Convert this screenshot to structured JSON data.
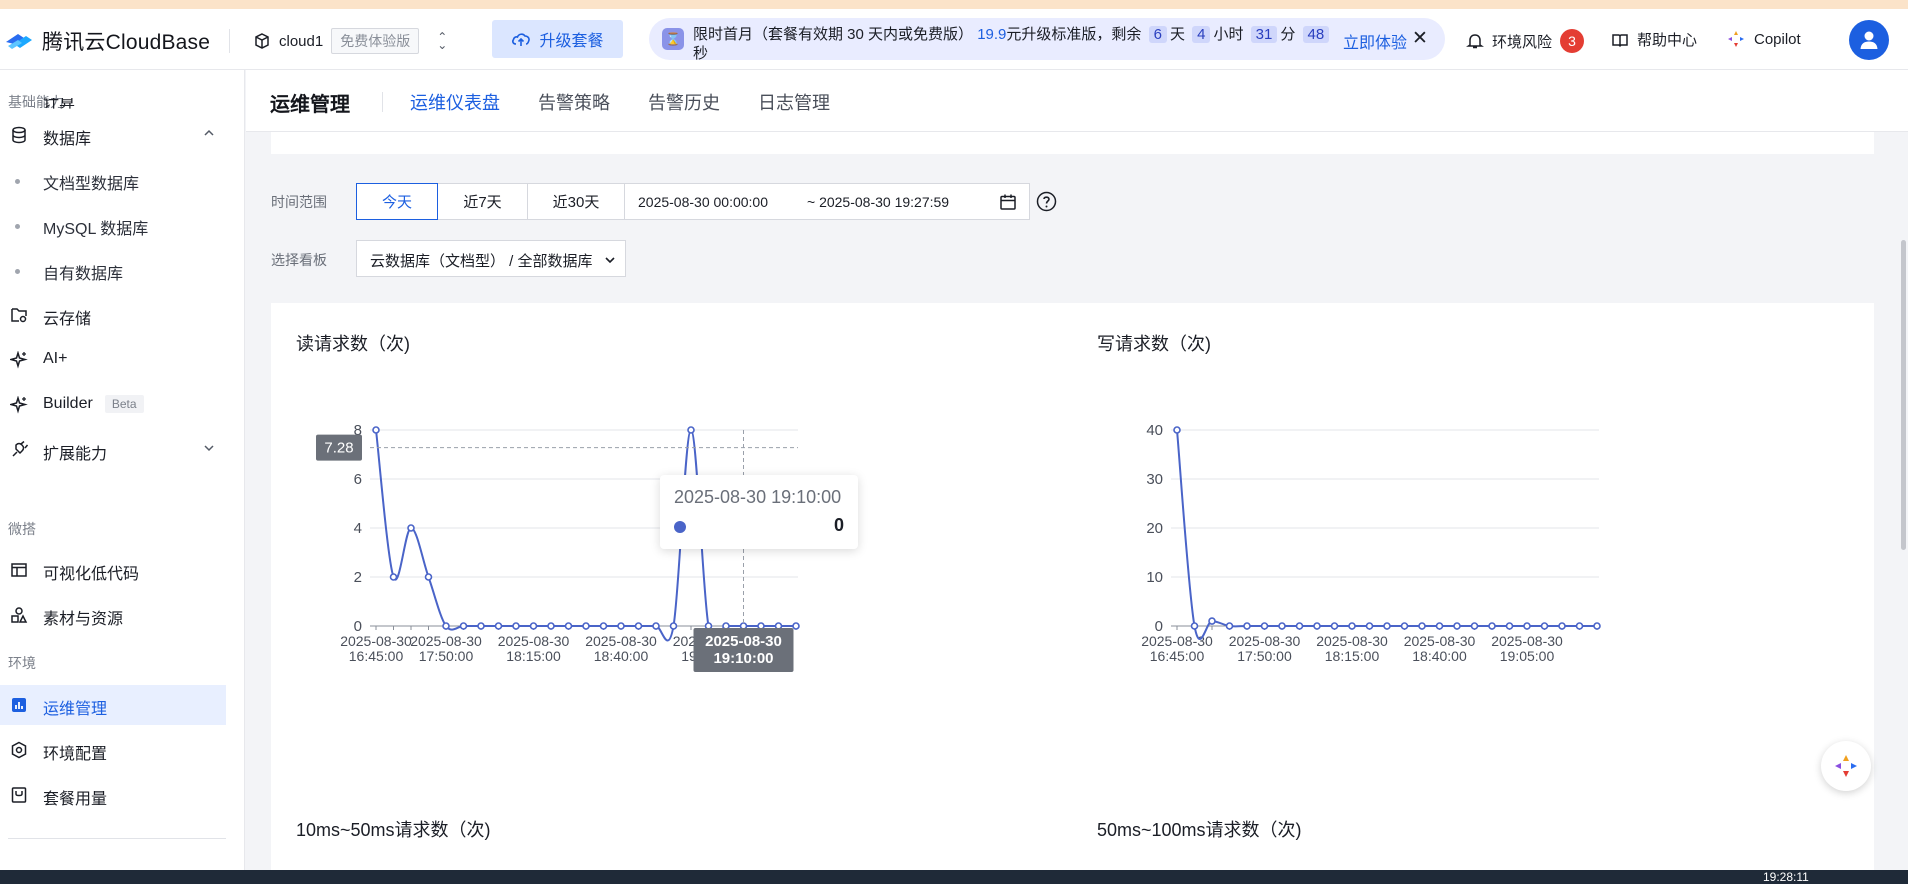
{
  "app": {
    "logo_text": "腾讯云CloudBase"
  },
  "header": {
    "env_name": "cloud1",
    "env_badge": "免费体验版",
    "upgrade_label": "升级套餐",
    "promo": {
      "line1_pre": "限时首月（套餐有效期 30 天内或免费版）",
      "price": "19.9",
      "line1_mid": "元升级标准版，剩余",
      "days": "6",
      "days_unit": "天",
      "hours": "4",
      "hours_unit": "小时",
      "minutes": "31",
      "minutes_unit": "分",
      "seconds": "48",
      "seconds_unit": "秒",
      "try_label": "立即体验"
    },
    "risk_label": "环境风险",
    "risk_count": "3",
    "help_label": "帮助中心",
    "copilot_label": "Copilot"
  },
  "sidebar": {
    "section_basic": "基础能力",
    "compute_partial": "计算",
    "database": "数据库",
    "doc_db": "文档型数据库",
    "mysql_db": "MySQL 数据库",
    "own_db": "自有数据库",
    "storage": "云存储",
    "ai": "AI+",
    "builder": "Builder",
    "builder_badge": "Beta",
    "extensions": "扩展能力",
    "section_weda": "微搭",
    "lowcode": "可视化低代码",
    "materials": "素材与资源",
    "section_env": "环境",
    "ops": "运维管理",
    "env_config": "环境配置",
    "usage": "套餐用量"
  },
  "page": {
    "title": "运维管理",
    "tabs": [
      "运维仪表盘",
      "告警策略",
      "告警历史",
      "日志管理"
    ]
  },
  "filters": {
    "time_label": "时间范围",
    "ranges": [
      "今天",
      "近7天",
      "近30天"
    ],
    "start": "2025-08-30 00:00:00",
    "end": "~ 2025-08-30 19:27:59",
    "board_label": "选择看板",
    "board_value": "云数据库（文档型）  / 全部数据库"
  },
  "charts_titles": {
    "read": "读请求数（次)",
    "write": "写请求数（次)",
    "c10_50": "10ms~50ms请求数（次)",
    "c50_100": "50ms~100ms请求数（次)"
  },
  "tooltip": {
    "time": "2025-08-30 19:10:00",
    "value": "0"
  },
  "crosshair": {
    "y_label": "7.28",
    "x_label_line1": "2025-08-30",
    "x_label_line2": "19:10:00"
  },
  "colors": {
    "accent": "#1c5fe0",
    "series": "#4a64c8",
    "risk": "#e43d33"
  },
  "chart_data": [
    {
      "type": "line",
      "title": "读请求数（次)",
      "ylim": [
        0,
        8
      ],
      "yticks": [
        0,
        2,
        4,
        6,
        8
      ],
      "xtick_labels": [
        [
          "2025-08-30",
          "16:45:00"
        ],
        [
          "2025-08-30",
          "17:50:00"
        ],
        [
          "2025-08-30",
          "18:15:00"
        ],
        [
          "2025-08-30",
          "18:40:00"
        ],
        [
          "2025-08-30",
          "19:05:00"
        ]
      ],
      "x_label_at": [
        0,
        4,
        9,
        14,
        19
      ],
      "x": [
        "16:45",
        "16:50",
        "16:55",
        "17:00",
        "17:05",
        "17:10",
        "17:15",
        "17:20",
        "17:25",
        "17:30",
        "17:35",
        "17:40",
        "17:45",
        "17:50",
        "17:55",
        "18:00",
        "18:05",
        "18:10",
        "18:15",
        "18:20",
        "18:25",
        "18:30",
        "18:35",
        "18:40",
        "18:45",
        "18:50",
        "18:55",
        "19:00",
        "19:05",
        "19:10",
        "19:15",
        "19:20",
        "19:25"
      ],
      "values": [
        8,
        2,
        4,
        2,
        0,
        0,
        0,
        0,
        0,
        0,
        0,
        0,
        0,
        0,
        0,
        0,
        0,
        0,
        8,
        0,
        0,
        0,
        0,
        0,
        0
      ],
      "grid": true
    },
    {
      "type": "line",
      "title": "写请求数（次)",
      "ylim": [
        0,
        40
      ],
      "yticks": [
        0,
        10,
        20,
        30,
        40
      ],
      "xtick_labels": [
        [
          "2025-08-30",
          "16:45:00"
        ],
        [
          "2025-08-30",
          "17:50:00"
        ],
        [
          "2025-08-30",
          "18:15:00"
        ],
        [
          "2025-08-30",
          "18:40:00"
        ],
        [
          "2025-08-30",
          "19:05:00"
        ]
      ],
      "x_label_at": [
        0,
        5,
        10,
        15,
        20
      ],
      "values": [
        40,
        0,
        1,
        0,
        0,
        0,
        0,
        0,
        0,
        0,
        0,
        0,
        0,
        0,
        0,
        0,
        0,
        0,
        0,
        0,
        0,
        0,
        0,
        0,
        0
      ],
      "grid": true
    }
  ],
  "clock": "19:28:11"
}
